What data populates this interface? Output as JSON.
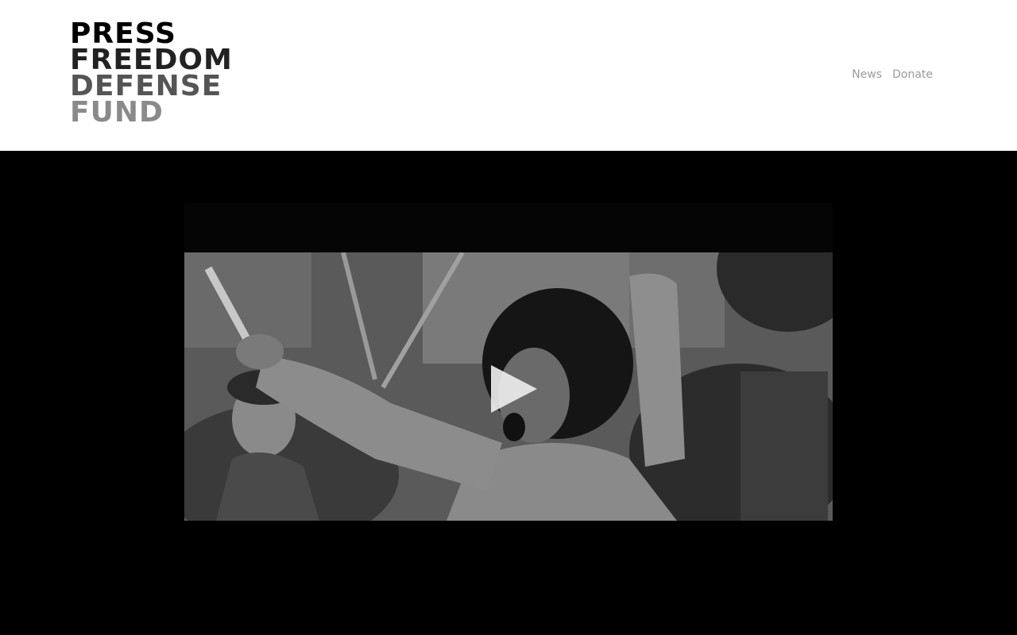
{
  "logo": {
    "line1": "PRESS",
    "line2": "FREEDOM",
    "line3": "DEFENSE",
    "line4": "FUND"
  },
  "nav": {
    "items": [
      {
        "label": "News"
      },
      {
        "label": "Donate"
      }
    ]
  },
  "video": {
    "play_icon": "play-icon",
    "still_description_icon": "video-thumbnail"
  },
  "colors": {
    "header_bg": "#ffffff",
    "hero_bg": "#000000",
    "nav_text": "#9a9a9a"
  }
}
